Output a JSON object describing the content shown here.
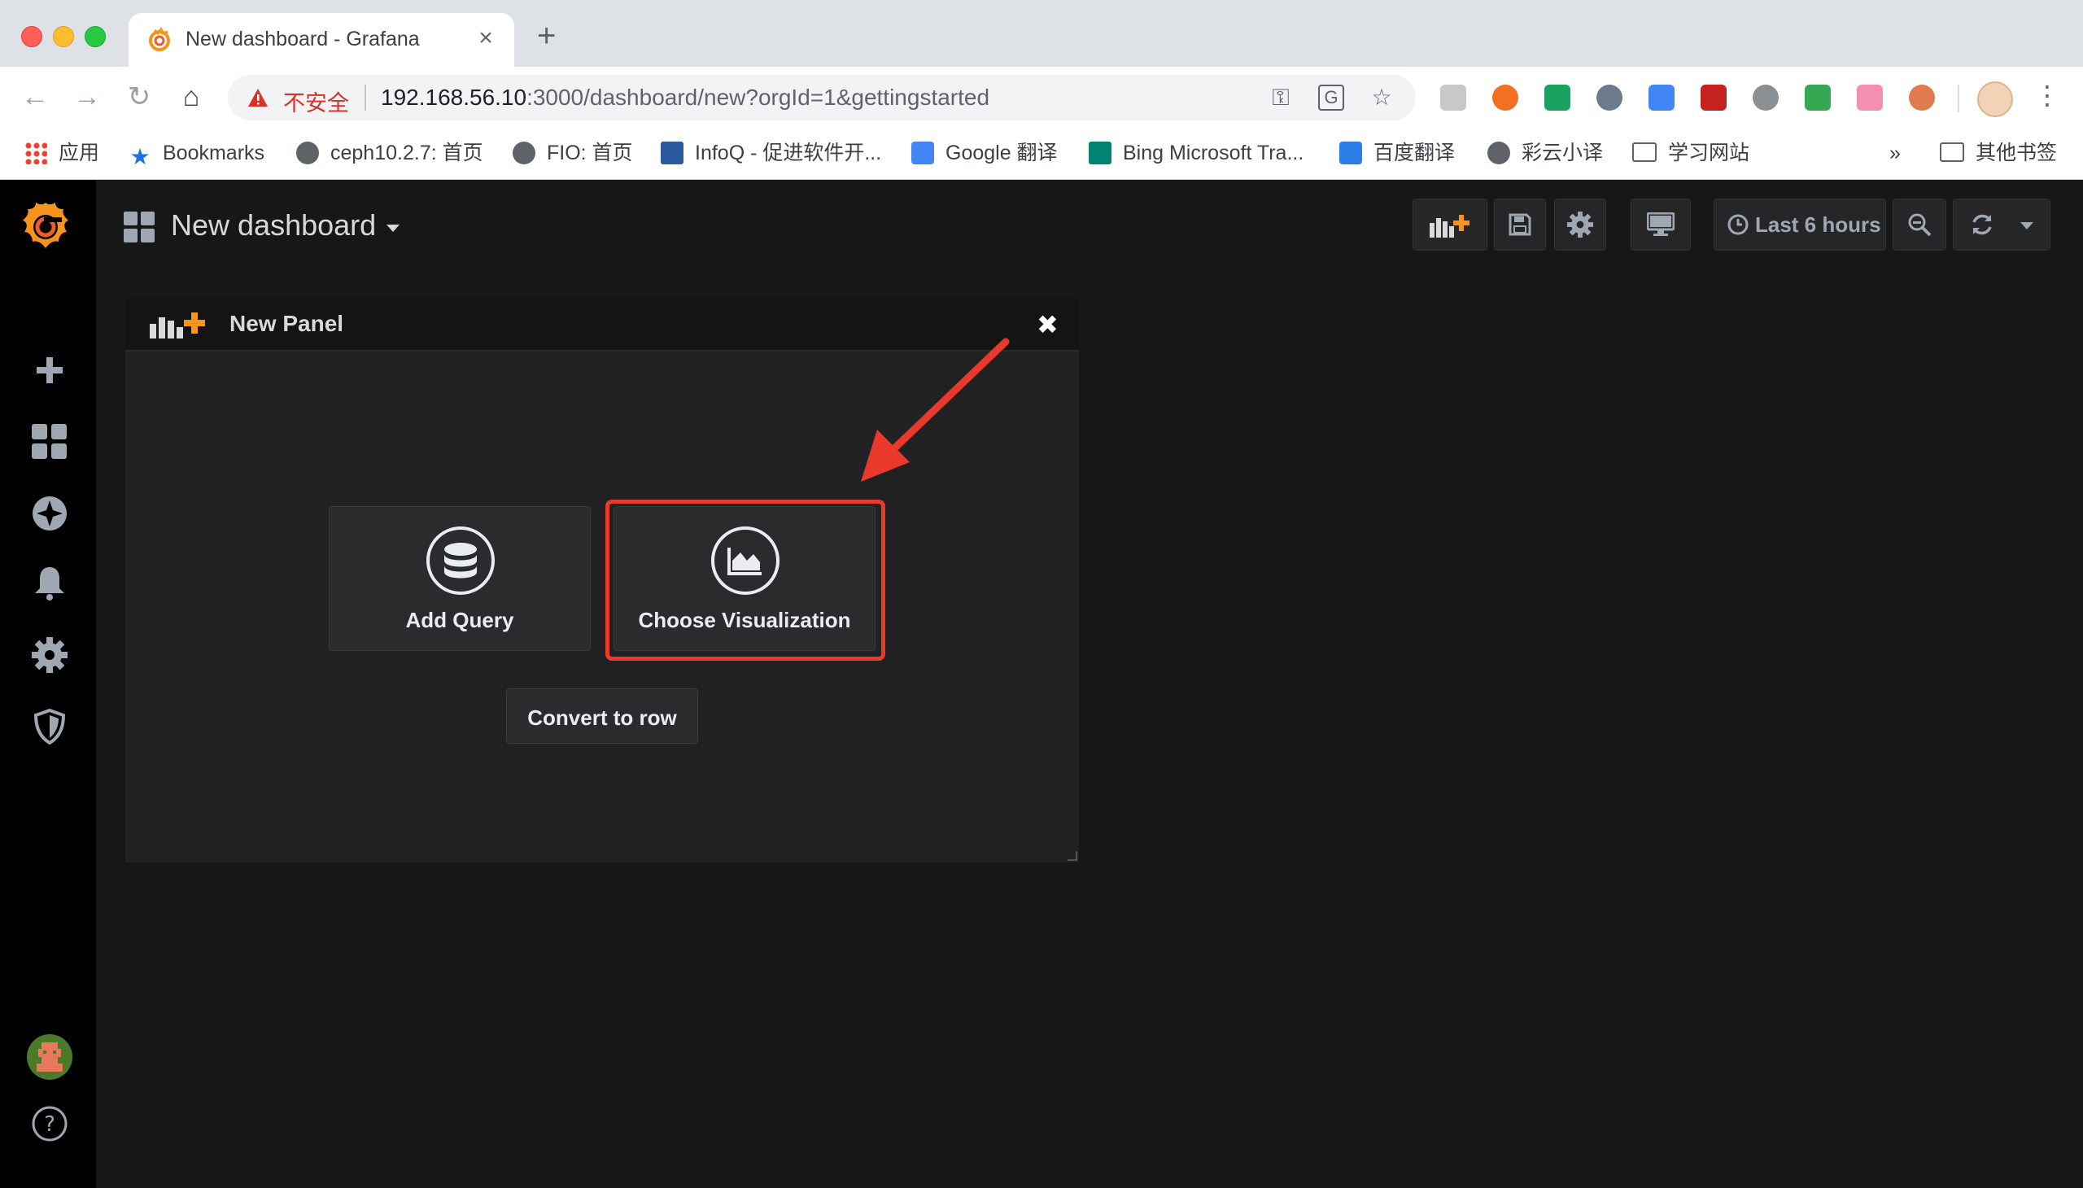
{
  "browser": {
    "tab_title": "New dashboard - Grafana",
    "new_tab": "+",
    "insecure_label": "不安全",
    "url_host": "192.168.56.10",
    "url_rest": ":3000/dashboard/new?orgId=1&gettingstarted",
    "bookmarks": [
      {
        "label": "应用",
        "icon": "apps-icon"
      },
      {
        "label": "Bookmarks",
        "icon": "star-icon"
      },
      {
        "label": "ceph10.2.7: 首页",
        "icon": "globe-icon"
      },
      {
        "label": "FIO: 首页",
        "icon": "globe-icon"
      },
      {
        "label": "InfoQ - 促进软件开...",
        "icon": "infoq-icon"
      },
      {
        "label": "Google 翻译",
        "icon": "google-translate-icon"
      },
      {
        "label": "Bing Microsoft Tra...",
        "icon": "bing-icon"
      },
      {
        "label": "百度翻译",
        "icon": "baidu-translate-icon"
      },
      {
        "label": "彩云小译",
        "icon": "globe-icon"
      },
      {
        "label": "学习网站",
        "icon": "folder-icon"
      }
    ],
    "overflow": "»",
    "other_bookmarks": "其他书签"
  },
  "grafana": {
    "dashboard_title": "New dashboard",
    "time_picker": "Last 6 hours",
    "panel": {
      "title": "New Panel",
      "close": "✖",
      "add_query": "Add Query",
      "choose_visualization": "Choose Visualization",
      "convert_to_row": "Convert to row"
    }
  },
  "colors": {
    "accent_orange": "#f7941d",
    "highlight_red": "#e8392a"
  }
}
